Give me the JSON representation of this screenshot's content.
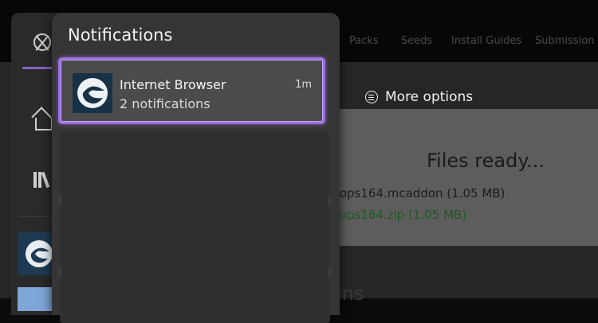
{
  "background": {
    "nav": [
      "Packs",
      "Seeds",
      "Install Guides",
      "Submission"
    ],
    "more_options": "More options",
    "files_title": "Files ready...",
    "file1": "rops164.mcaddon (1.05 MB)",
    "file2": "rops164.zip (1.05 MB)",
    "partial_text": "ons"
  },
  "guide": {
    "icons": [
      "xbox-logo-icon",
      "home-icon",
      "library-icon"
    ],
    "accent": "#8a63c9"
  },
  "notifications": {
    "title": "Notifications",
    "items": [
      {
        "app": "Internet Browser",
        "count": "2 notifications",
        "time": "1m",
        "icon": "edge-browser-icon"
      }
    ],
    "focus_color": "#9b6fe0"
  }
}
